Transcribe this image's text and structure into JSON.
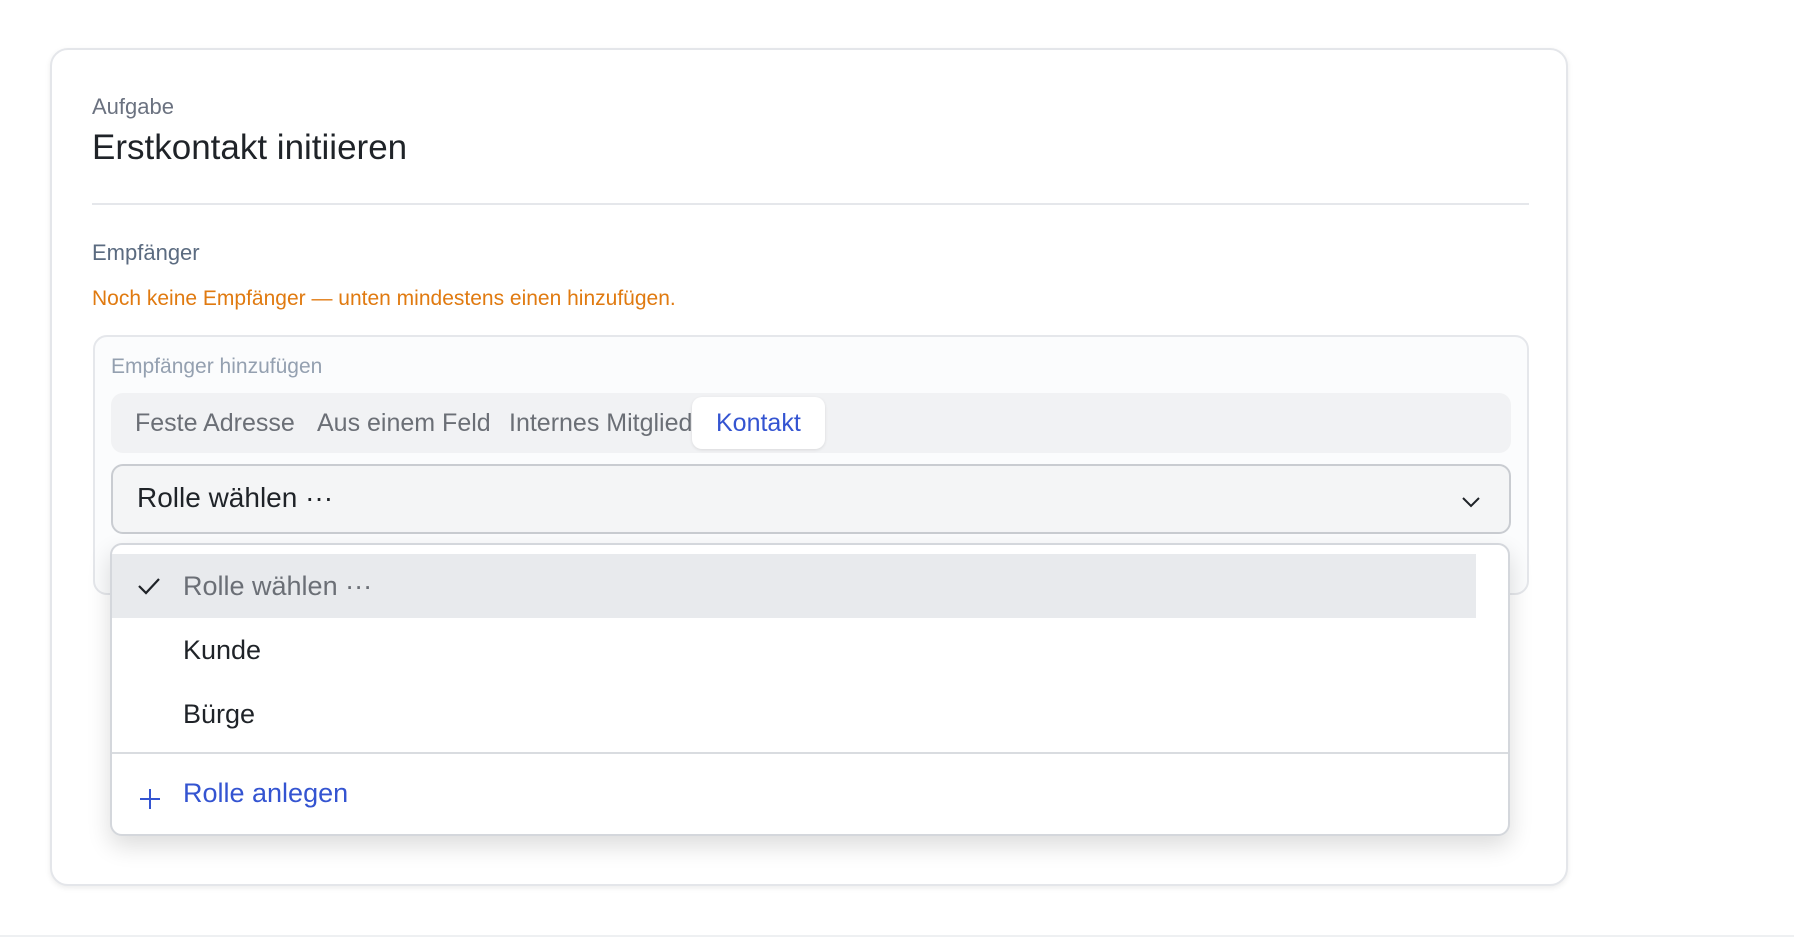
{
  "card": {
    "eyebrow": "Aufgabe",
    "title": "Erstkontakt initiieren"
  },
  "recipients": {
    "label": "Empfänger",
    "warning": "Noch keine Empfänger — unten mindestens einen hinzufügen."
  },
  "add_recipient": {
    "label": "Empfänger hinzufügen",
    "tabs": [
      {
        "label": "Feste Adresse",
        "active": false
      },
      {
        "label": "Aus einem Feld",
        "active": false
      },
      {
        "label": "Internes Mitglied",
        "active": false
      },
      {
        "label": "Kontakt",
        "active": true
      }
    ],
    "select_value": "Rolle wählen ···"
  },
  "dropdown": {
    "options": [
      {
        "label": "Rolle wählen ···",
        "selected": true
      },
      {
        "label": "Kunde",
        "selected": false
      },
      {
        "label": "Bürge",
        "selected": false
      }
    ],
    "create_label": "Rolle anlegen"
  },
  "icons": {
    "check": "check-icon",
    "chevron": "chevron-down-icon",
    "plus": "plus-icon"
  },
  "colors": {
    "accent": "#3454d1",
    "warning": "#e07a10"
  }
}
